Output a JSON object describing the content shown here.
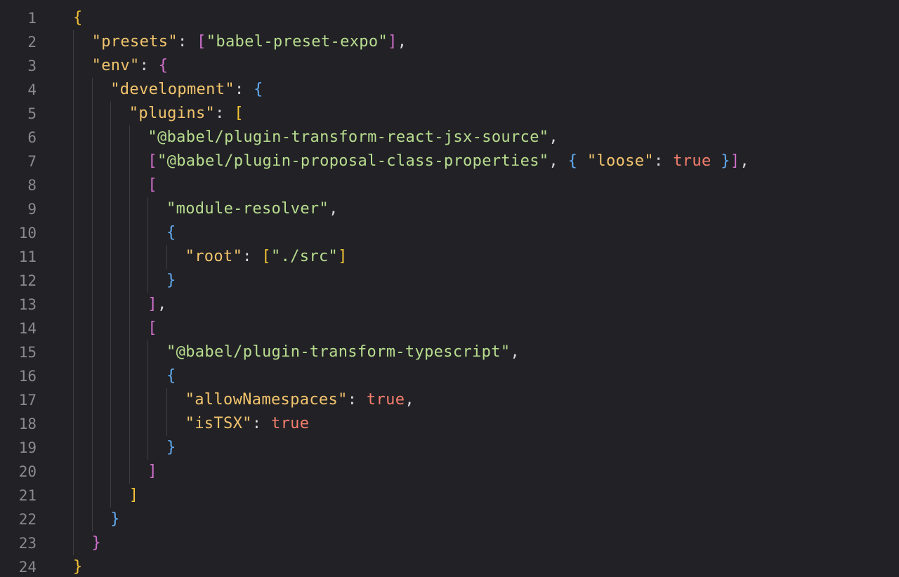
{
  "theme": {
    "background": "#222226",
    "key_color": "#f2c46d",
    "string_color": "#b8dd8f",
    "boolean_color": "#f57e6d",
    "bracket_yellow": "#f3c236",
    "bracket_magenta": "#d16fcb",
    "bracket_blue": "#62abf0",
    "line_number_color": "#8a8a8f"
  },
  "lines": [
    {
      "n": "1",
      "t": [
        [
          "y",
          "{"
        ]
      ]
    },
    {
      "n": "2",
      "t": [
        [
          "k",
          "\"presets\""
        ],
        [
          "p",
          ": "
        ],
        [
          "m",
          "["
        ],
        [
          "s",
          "\"babel-preset-expo\""
        ],
        [
          "m",
          "]"
        ],
        [
          "p",
          ","
        ]
      ]
    },
    {
      "n": "3",
      "t": [
        [
          "k",
          "\"env\""
        ],
        [
          "p",
          ": "
        ],
        [
          "m",
          "{"
        ]
      ]
    },
    {
      "n": "4",
      "t": [
        [
          "k",
          "\"development\""
        ],
        [
          "p",
          ": "
        ],
        [
          "c",
          "{"
        ]
      ]
    },
    {
      "n": "5",
      "t": [
        [
          "k",
          "\"plugins\""
        ],
        [
          "p",
          ": "
        ],
        [
          "y",
          "["
        ]
      ]
    },
    {
      "n": "6",
      "t": [
        [
          "s",
          "\"@babel/plugin-transform-react-jsx-source\""
        ],
        [
          "p",
          ","
        ]
      ]
    },
    {
      "n": "7",
      "t": [
        [
          "m",
          "["
        ],
        [
          "s",
          "\"@babel/plugin-proposal-class-properties\""
        ],
        [
          "p",
          ", "
        ],
        [
          "c",
          "{"
        ],
        [
          "p",
          " "
        ],
        [
          "k",
          "\"loose\""
        ],
        [
          "p",
          ": "
        ],
        [
          "b",
          "true"
        ],
        [
          "p",
          " "
        ],
        [
          "c",
          "}"
        ],
        [
          "m",
          "]"
        ],
        [
          "p",
          ","
        ]
      ]
    },
    {
      "n": "8",
      "t": [
        [
          "m",
          "["
        ]
      ]
    },
    {
      "n": "9",
      "t": [
        [
          "s",
          "\"module-resolver\""
        ],
        [
          "p",
          ","
        ]
      ]
    },
    {
      "n": "10",
      "t": [
        [
          "c",
          "{"
        ]
      ]
    },
    {
      "n": "11",
      "t": [
        [
          "k",
          "\"root\""
        ],
        [
          "p",
          ": "
        ],
        [
          "y",
          "["
        ],
        [
          "s",
          "\"./src\""
        ],
        [
          "y",
          "]"
        ]
      ]
    },
    {
      "n": "12",
      "t": [
        [
          "c",
          "}"
        ]
      ]
    },
    {
      "n": "13",
      "t": [
        [
          "m",
          "]"
        ],
        [
          "p",
          ","
        ]
      ]
    },
    {
      "n": "14",
      "t": [
        [
          "m",
          "["
        ]
      ]
    },
    {
      "n": "15",
      "t": [
        [
          "s",
          "\"@babel/plugin-transform-typescript\""
        ],
        [
          "p",
          ","
        ]
      ]
    },
    {
      "n": "16",
      "t": [
        [
          "c",
          "{"
        ]
      ]
    },
    {
      "n": "17",
      "t": [
        [
          "k",
          "\"allowNamespaces\""
        ],
        [
          "p",
          ": "
        ],
        [
          "b",
          "true"
        ],
        [
          "p",
          ","
        ]
      ]
    },
    {
      "n": "18",
      "t": [
        [
          "k",
          "\"isTSX\""
        ],
        [
          "p",
          ": "
        ],
        [
          "b",
          "true"
        ]
      ]
    },
    {
      "n": "19",
      "t": [
        [
          "c",
          "}"
        ]
      ]
    },
    {
      "n": "20",
      "t": [
        [
          "m",
          "]"
        ]
      ]
    },
    {
      "n": "21",
      "t": [
        [
          "y",
          "]"
        ]
      ]
    },
    {
      "n": "22",
      "t": [
        [
          "c",
          "}"
        ]
      ]
    },
    {
      "n": "23",
      "t": [
        [
          "m",
          "}"
        ]
      ]
    },
    {
      "n": "24",
      "t": [
        [
          "y",
          "}"
        ]
      ]
    }
  ]
}
